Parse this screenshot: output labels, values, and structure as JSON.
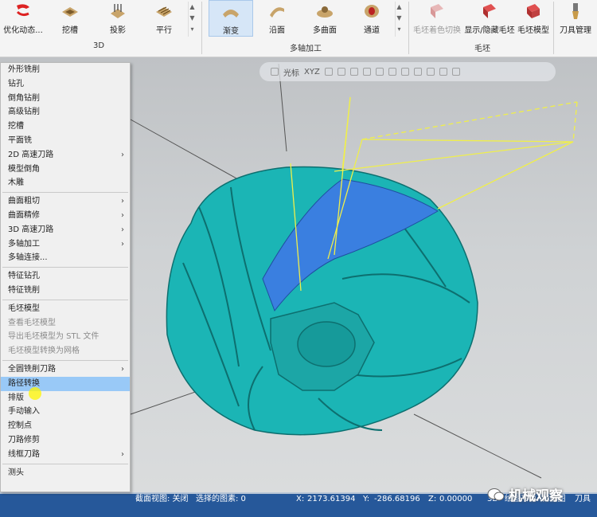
{
  "ribbon": {
    "groups": {
      "g3d": {
        "label": "3D",
        "buttons": [
          {
            "label": "优化动态..."
          },
          {
            "label": "挖槽"
          },
          {
            "label": "投影"
          },
          {
            "label": "平行"
          }
        ]
      },
      "multiaxis": {
        "label": "多轴加工",
        "buttons": [
          {
            "label": "渐变"
          },
          {
            "label": "沿面"
          },
          {
            "label": "多曲面"
          },
          {
            "label": "通道"
          }
        ]
      },
      "stock": {
        "label": "毛坯",
        "buttons": [
          {
            "label": "毛坯着色切换"
          },
          {
            "label": "显示/隐藏毛坯"
          },
          {
            "label": "毛坯模型"
          }
        ]
      },
      "tools": {
        "buttons": [
          {
            "label": "刀具管理"
          }
        ]
      }
    }
  },
  "view_toolbar": {
    "cursor_label": "光标",
    "xyz_label": "XYZ"
  },
  "context_menu": {
    "sections": [
      {
        "items": [
          {
            "label": "外形铣削",
            "submenu": false
          },
          {
            "label": "钻孔",
            "submenu": false
          },
          {
            "label": "倒角钻削",
            "submenu": false
          },
          {
            "label": "高级钻削",
            "submenu": false
          },
          {
            "label": "挖槽",
            "submenu": false
          },
          {
            "label": "平面铣",
            "submenu": false
          },
          {
            "label": "2D 高速刀路",
            "submenu": true
          },
          {
            "label": "模型倒角",
            "submenu": false
          },
          {
            "label": "木雕",
            "submenu": false
          }
        ]
      },
      {
        "items": [
          {
            "label": "曲面粗切",
            "submenu": true
          },
          {
            "label": "曲面精修",
            "submenu": true
          },
          {
            "label": "3D 高速刀路",
            "submenu": true
          },
          {
            "label": "多轴加工",
            "submenu": true
          },
          {
            "label": "多轴连接...",
            "submenu": false
          }
        ]
      },
      {
        "items": [
          {
            "label": "特征钻孔",
            "submenu": false
          },
          {
            "label": "特征铣削",
            "submenu": false
          }
        ]
      },
      {
        "items": [
          {
            "label": "毛坯模型",
            "submenu": false
          },
          {
            "label": "查看毛坯模型",
            "submenu": false,
            "disabled": true
          },
          {
            "label": "导出毛坯模型为 STL 文件",
            "submenu": false,
            "disabled": true
          },
          {
            "label": "毛坯模型转换为网格",
            "submenu": false,
            "disabled": true
          }
        ]
      },
      {
        "items": [
          {
            "label": "全圆铣削刀路",
            "submenu": true
          },
          {
            "label": "路径转换",
            "submenu": false,
            "highlighted": true
          },
          {
            "label": "排版",
            "submenu": false
          },
          {
            "label": "手动输入",
            "submenu": false
          },
          {
            "label": "控制点",
            "submenu": false
          },
          {
            "label": "刀路修剪",
            "submenu": false
          },
          {
            "label": "线框刀路",
            "submenu": true
          }
        ]
      },
      {
        "items": [
          {
            "label": "测头",
            "submenu": false
          }
        ]
      }
    ]
  },
  "status_bar": {
    "section_view": "截面视图: 关闭",
    "selected": "选择的图素: 0",
    "x_label": "X:",
    "x_value": "2173.61394",
    "y_label": "Y:",
    "y_value": "-286.68196",
    "z_label": "Z:",
    "z_value": "0.00000",
    "mode": "3D",
    "plane": "绘图平面: 俯视图",
    "tool": "刀具"
  },
  "watermark": {
    "text": "机械观察"
  },
  "colors": {
    "model": "#1bb5b5",
    "selected_surface": "#3a7fe0",
    "toolpath": "#f0ef4a",
    "statusbar": "#26589a",
    "menu_highlight": "#99c9f7"
  }
}
